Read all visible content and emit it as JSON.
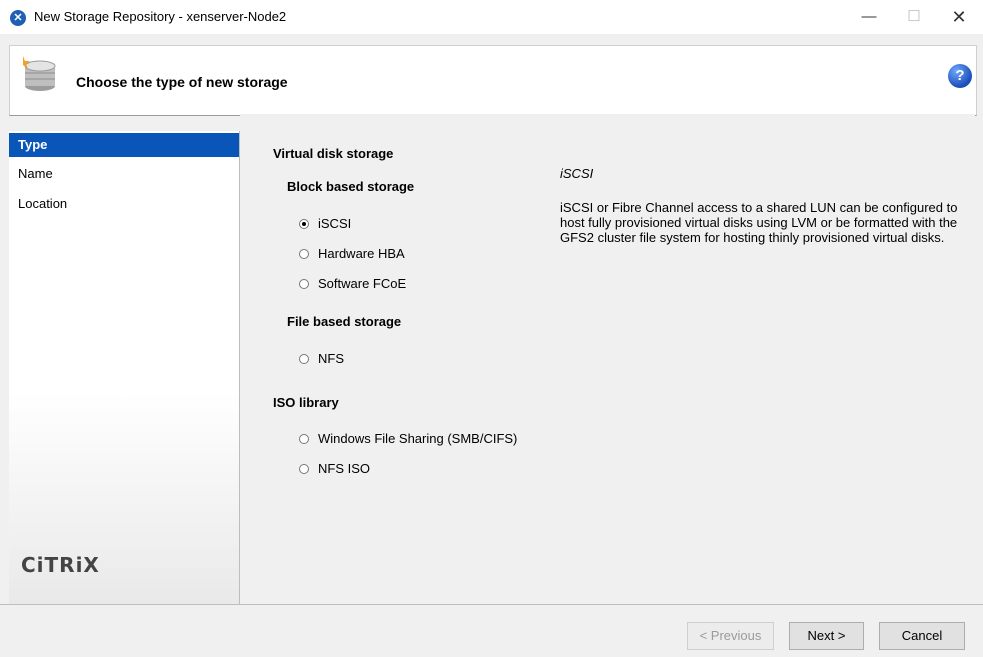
{
  "window": {
    "title": "New Storage Repository - xenserver-Node2"
  },
  "header": {
    "title": "Choose the type of new storage"
  },
  "sidebar": {
    "items": [
      {
        "label": "Type"
      },
      {
        "label": "Name"
      },
      {
        "label": "Location"
      }
    ],
    "logo": "CiTRiX"
  },
  "content": {
    "virtual_disk_storage": "Virtual disk storage",
    "block_based": "Block based storage",
    "block_options": [
      "iSCSI",
      "Hardware HBA",
      "Software FCoE"
    ],
    "file_based": "File based storage",
    "file_options": [
      "NFS"
    ],
    "iso_library": "ISO library",
    "iso_options": [
      "Windows File Sharing (SMB/CIFS)",
      "NFS ISO"
    ],
    "selected": "iSCSI",
    "description_title": "iSCSI",
    "description_body": "iSCSI or Fibre Channel access to a shared LUN can be configured to host fully provisioned virtual disks using LVM or be formatted with the GFS2 cluster file system for hosting thinly provisioned virtual disks."
  },
  "buttons": {
    "previous": "< Previous",
    "next": "Next >",
    "cancel": "Cancel"
  }
}
